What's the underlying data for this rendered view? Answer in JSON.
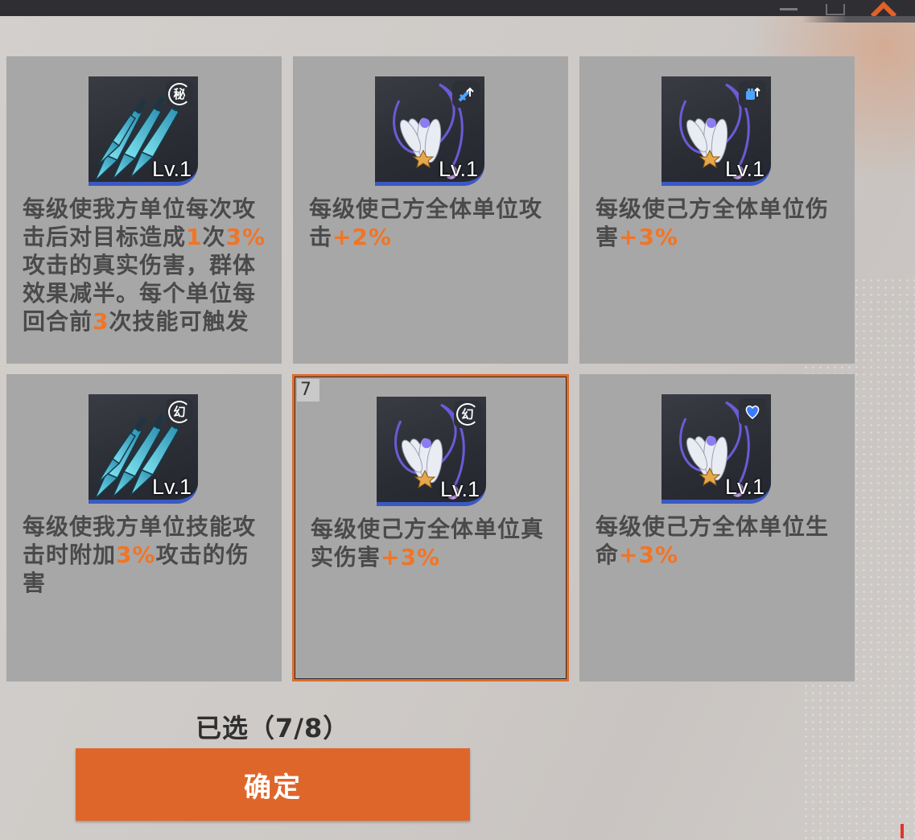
{
  "window": {
    "accent_color": "#df662a"
  },
  "cards": [
    {
      "level": "Lv.1",
      "tag": "秘",
      "tag_type": "text",
      "art": "daggers",
      "desc_parts": [
        {
          "text": "每级使我方单位每次攻击后对目标造成",
          "hl": false
        },
        {
          "text": "1",
          "hl": true
        },
        {
          "text": "次",
          "hl": false
        },
        {
          "text": "3%",
          "hl": true
        },
        {
          "text": "攻击的真实伤害，群体效果减半。每个单位每回合前",
          "hl": false
        },
        {
          "text": "3",
          "hl": true
        },
        {
          "text": "次技能可触发",
          "hl": false
        }
      ],
      "selected": false
    },
    {
      "level": "Lv.1",
      "tag": "sword-up-icon",
      "tag_type": "icon",
      "art": "necklace",
      "desc_parts": [
        {
          "text": "每级使己方全体单位攻击",
          "hl": false
        },
        {
          "text": "+2%",
          "hl": true
        }
      ],
      "selected": false
    },
    {
      "level": "Lv.1",
      "tag": "fist-up-icon",
      "tag_type": "icon",
      "art": "necklace",
      "desc_parts": [
        {
          "text": "每级使己方全体单位伤害",
          "hl": false
        },
        {
          "text": "+3%",
          "hl": true
        }
      ],
      "selected": false
    },
    {
      "level": "Lv.1",
      "tag": "幻",
      "tag_type": "text",
      "art": "daggers",
      "desc_parts": [
        {
          "text": "每级使我方单位技能攻击时附加",
          "hl": false
        },
        {
          "text": "3%",
          "hl": true
        },
        {
          "text": "攻击的伤害",
          "hl": false
        }
      ],
      "selected": false
    },
    {
      "level": "Lv.1",
      "tag": "幻",
      "tag_type": "text",
      "art": "necklace",
      "badge": "7",
      "desc_parts": [
        {
          "text": "每级使己方全体单位真实伤害",
          "hl": false
        },
        {
          "text": "+3%",
          "hl": true
        }
      ],
      "selected": true
    },
    {
      "level": "Lv.1",
      "tag": "heart-icon",
      "tag_type": "icon",
      "art": "necklace",
      "desc_parts": [
        {
          "text": "每级使己方全体单位生命",
          "hl": false
        },
        {
          "text": "+3%",
          "hl": true
        }
      ],
      "selected": false
    }
  ],
  "footer": {
    "selected_count": "已选（7/8）",
    "confirm_label": "确定"
  }
}
